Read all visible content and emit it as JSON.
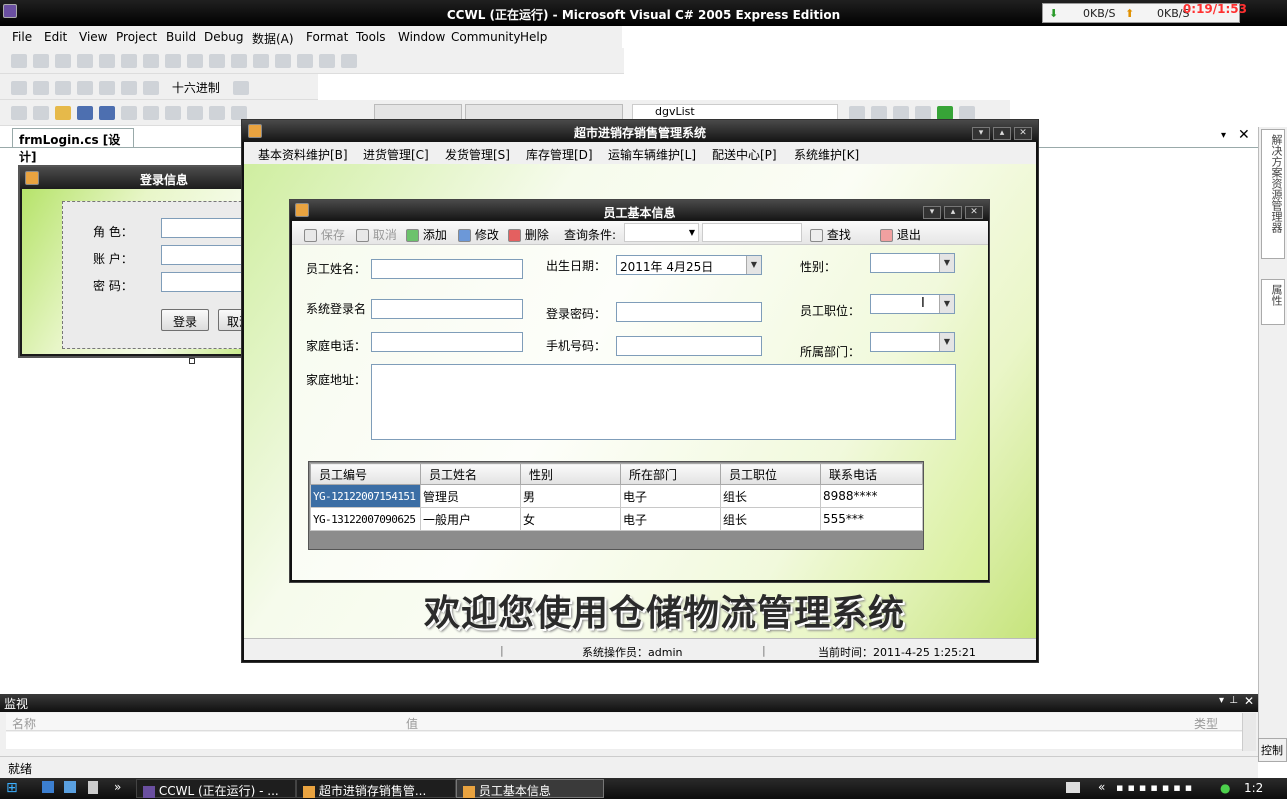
{
  "vs": {
    "title": "CCWL (正在运行) - Microsoft Visual C# 2005 Express Edition",
    "net_down": "0KB/S",
    "net_up": "0KB/S",
    "clock_overlay": "0:19/1:53",
    "menu": [
      "File",
      "Edit",
      "View",
      "Project",
      "Build",
      "Debug",
      "数据(A)",
      "Format",
      "Tools",
      "Window",
      "Community",
      "Help"
    ],
    "hex_toggle": "十六进制",
    "object_combo": "dgvList",
    "doc_tab": "frmLogin.cs [设计]",
    "status": "就绪"
  },
  "right_dock": {
    "solution_tab": "解决方案资源管理器",
    "props_tab": "属性"
  },
  "login": {
    "title": "登录信息",
    "role_label": "角 色：",
    "account_label": "账 户：",
    "password_label": "密 码：",
    "login_button": "登录",
    "cancel_button": "取消"
  },
  "main_window": {
    "title": "超市进销存销售管理系统",
    "menu": [
      "基本资料维护[B]",
      "进货管理[C]",
      "发货管理[S]",
      "库存管理[D]",
      "运输车辆维护[L]",
      "配送中心[P]",
      "系统维护[K]"
    ],
    "welcome": "欢迎您使用仓储物流管理系统",
    "operator": "系统操作员：admin",
    "current_time": "当前时间：2011-4-25 1:25:21"
  },
  "employee": {
    "title": "员工基本信息",
    "toolbar": {
      "save": "保存",
      "cancel": "取消",
      "add": "添加",
      "edit": "修改",
      "delete": "删除",
      "query_label": "查询条件:",
      "find": "查找",
      "exit": "退出"
    },
    "form": {
      "name_label": "员工姓名：",
      "birth_label": "出生日期：",
      "birth_value": "2011年 4月25日",
      "gender_label": "性别：",
      "login_name_label": "系统登录名",
      "login_pwd_label": "登录密码：",
      "position_label": "员工职位：",
      "home_phone_label": "家庭电话：",
      "mobile_label": "手机号码：",
      "dept_label": "所属部门：",
      "address_label": "家庭地址："
    },
    "grid": {
      "columns": [
        "员工编号",
        "员工姓名",
        "性别",
        "所在部门",
        "员工职位",
        "联系电话"
      ],
      "rows": [
        [
          "YG-12122007154151",
          "管理员",
          "男",
          "电子",
          "组长",
          "8988****"
        ],
        [
          "YG-13122007090625",
          "一般用户",
          "女",
          "电子",
          "组长",
          "555***"
        ]
      ]
    }
  },
  "watch": {
    "title": "监视",
    "col_name": "名称",
    "col_value": "值",
    "col_type": "类型",
    "side_tab": "控制"
  },
  "taskbar": {
    "tasks": [
      "CCWL (正在运行) - ...",
      "超市进销存销售管...",
      "员工基本信息"
    ],
    "clock": "1:2"
  }
}
